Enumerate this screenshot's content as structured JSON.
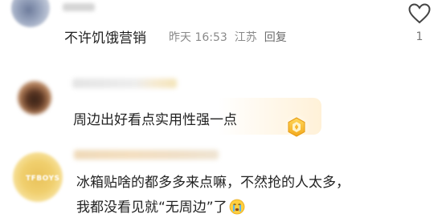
{
  "comments": [
    {
      "text": "不许饥饿营销",
      "time": "昨天 16:53",
      "location": "江苏",
      "reply_label": "回复",
      "like_count": "1",
      "avatar_icon": "blurred-avatar-icon",
      "like_icon": "heart-outline-icon"
    },
    {
      "text": "周边出好看点实用性强一点",
      "avatar_icon": "blurred-avatar-icon",
      "badge_icon": "gold-badge-icon"
    },
    {
      "line1": "冰箱贴啥的都多多来点嘛，不然抢的人太多，",
      "line2": "我都没看见就“无周边”了",
      "avatar_badge_text": "TFBOYS",
      "avatar_icon": "blurred-avatar-icon",
      "emoji_icon": "crying-face-icon"
    }
  ],
  "colors": {
    "text": "#222222",
    "meta": "#8a8a8a",
    "bubble_accent": "#fff1d8"
  }
}
